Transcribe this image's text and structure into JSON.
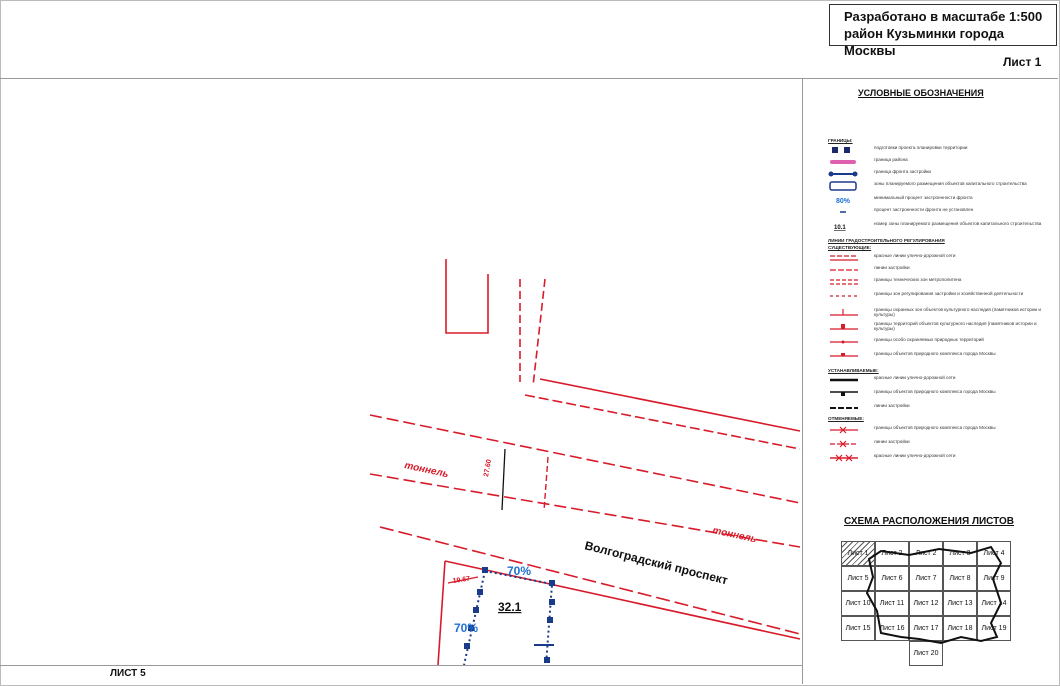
{
  "title_block": {
    "line1": "Разработано в масштабе 1:500",
    "line2": "район Кузьминки города Москвы"
  },
  "sheet_label": "Лист 1",
  "bottom_label": "ЛИСТ 5",
  "map": {
    "street_name": "Волгоградский проспект",
    "tunnel_label_1": "тоннель",
    "tunnel_label_2": "тоннель",
    "dim_width": "27.60",
    "dim_left": "19.67",
    "zone_number": "32.1",
    "percent_top": "70%",
    "percent_left": "70%"
  },
  "legend": {
    "title": "УСЛОВНЫЕ ОБОЗНАЧЕНИЯ",
    "section1_head": "ГРАНИЦЫ:",
    "rows": [
      {
        "text": "подготовки проекта планировки территории"
      },
      {
        "text": "граница района"
      },
      {
        "text": "граница фронта застройки"
      },
      {
        "text": "зоны планируемого размещения объектов капитального строительства"
      },
      {
        "text": "минимальный процент застроенности фронта"
      },
      {
        "text": "процент застроенности фронта не установлен"
      },
      {
        "text": "номер зоны планируемого размещения объектов капитального строительства"
      }
    ],
    "section2_head": "ЛИНИИ ГРАДОСТРОИТЕЛЬНОГО РЕГУЛИРОВАНИЯ",
    "section2_sub": "СУЩЕСТВУЮЩИЕ:",
    "rows2": [
      {
        "text": "красные линии улично-дорожной сети"
      },
      {
        "text": "линии застройки"
      },
      {
        "text": "границы технических зон метрополитена"
      },
      {
        "text": "границы зон регулирования застройки и хозяйственной деятельности"
      },
      {
        "text": "границы охранных зон объектов культурного наследия (памятников истории и культуры)"
      },
      {
        "text": "границы территорий объектов культурного наследия (памятников истории и культуры)"
      },
      {
        "text": "границы особо охраняемых природных территорий"
      },
      {
        "text": "границы объектов природного комплекса города Москвы"
      }
    ],
    "section3_head": "УСТАНАВЛИВАЕМЫЕ:",
    "rows3": [
      {
        "text": "красные линии улично-дорожной сети"
      },
      {
        "text": "границы объектов природного комплекса города Москвы"
      },
      {
        "text": "линии застройки"
      }
    ],
    "section4_head": "ОТМЕНЯЕМЫЕ:",
    "rows4": [
      {
        "text": "границы объектов природного комплекса города Москвы"
      },
      {
        "text": "линии застройки"
      },
      {
        "text": "красные линии улично-дорожной сети"
      }
    ]
  },
  "scheme": {
    "title": "СХЕМА РАСПОЛОЖЕНИЯ ЛИСТОВ",
    "cells": [
      {
        "label": "Лист 1"
      },
      {
        "label": "Лист 2"
      },
      {
        "label": "Лист 3"
      },
      {
        "label": "Лист 4"
      },
      {
        "label": "Лист 5"
      },
      {
        "label": "Лист 6"
      },
      {
        "label": "Лист 7"
      },
      {
        "label": "Лист 8"
      },
      {
        "label": "Лист 9"
      },
      {
        "label": "Лист 10"
      },
      {
        "label": "Лист 11"
      },
      {
        "label": "Лист 12"
      },
      {
        "label": "Лист 13"
      },
      {
        "label": "Лист 14"
      },
      {
        "label": "Лист 15"
      },
      {
        "label": "Лист 16"
      },
      {
        "label": "Лист 17"
      },
      {
        "label": "Лист 18"
      },
      {
        "label": "Лист 19"
      },
      {
        "label": "Лист 20"
      }
    ]
  },
  "colors": {
    "red_line": "#d81b2a",
    "blue_zone": "#1a3a8a",
    "percent_blue": "#1f6fd0",
    "pink_border": "#e060b0"
  }
}
